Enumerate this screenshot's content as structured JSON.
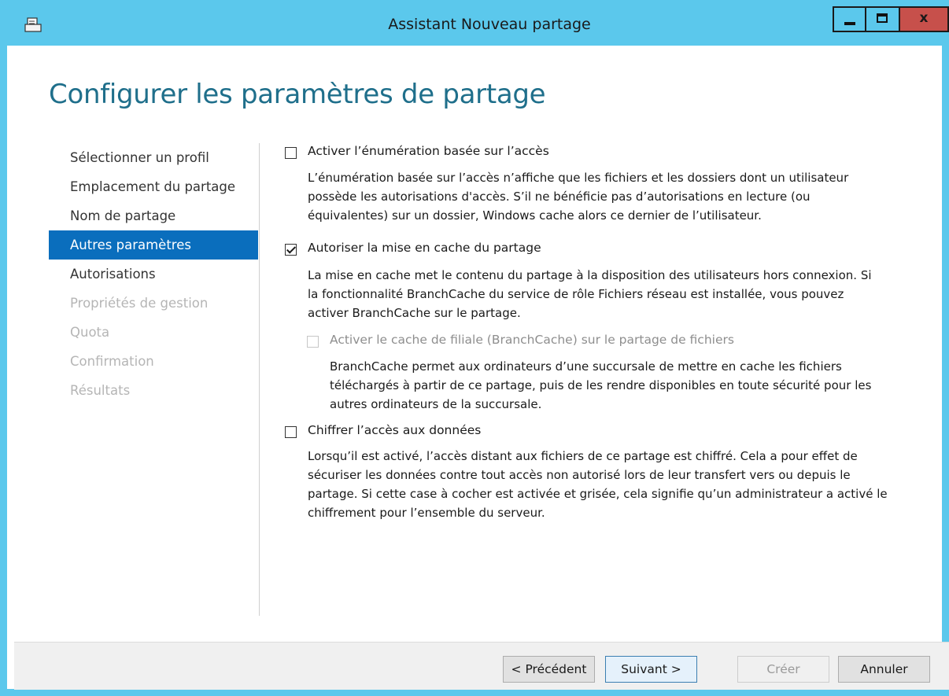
{
  "window": {
    "title": "Assistant Nouveau partage",
    "close_glyph": "x"
  },
  "page": {
    "heading": "Configurer les paramètres de partage"
  },
  "nav": {
    "items": [
      {
        "label": "Sélectionner un profil",
        "state": "normal"
      },
      {
        "label": "Emplacement du partage",
        "state": "normal"
      },
      {
        "label": "Nom de partage",
        "state": "normal"
      },
      {
        "label": "Autres paramètres",
        "state": "selected"
      },
      {
        "label": "Autorisations",
        "state": "normal"
      },
      {
        "label": "Propriétés de gestion",
        "state": "disabled"
      },
      {
        "label": "Quota",
        "state": "disabled"
      },
      {
        "label": "Confirmation",
        "state": "disabled"
      },
      {
        "label": "Résultats",
        "state": "disabled"
      }
    ]
  },
  "options": {
    "access_enum": {
      "label": "Activer l’énumération basée sur l’accès",
      "checked": false,
      "desc_lines": [
        "L’énumération basée sur l’accès n’affiche que les fichiers et les dossiers dont un utilisateur",
        "possède les autorisations d'accès. S’il ne bénéficie pas d’autorisations en lecture (ou",
        "équivalentes) sur un dossier, Windows cache alors ce dernier de l’utilisateur."
      ]
    },
    "caching": {
      "label": "Autoriser la mise en cache du partage",
      "checked": true,
      "desc_lines": [
        "La mise en cache met le contenu du partage à la disposition des utilisateurs hors connexion. Si",
        "la fonctionnalité BranchCache du service de rôle Fichiers réseau est installée, vous pouvez",
        "activer BranchCache sur le partage."
      ]
    },
    "branchcache": {
      "label": "Activer le cache de filiale (BranchCache) sur le partage de fichiers",
      "checked": false,
      "enabled": false,
      "desc_lines": [
        "BranchCache permet aux ordinateurs d’une succursale de mettre en cache les fichiers",
        "téléchargés à partir de ce partage, puis de les rendre disponibles en toute sécurité pour les",
        "autres ordinateurs de la succursale."
      ]
    },
    "encrypt": {
      "label": "Chiffrer l’accès aux données",
      "checked": false,
      "desc_lines": [
        "Lorsqu’il est activé, l’accès distant aux fichiers de ce partage est chiffré. Cela a pour effet de",
        "sécuriser les données contre tout accès non autorisé lors de leur transfert vers ou depuis le",
        "partage. Si cette case à cocher est activée et grisée, cela signifie qu’un administrateur a activé le",
        "chiffrement pour l’ensemble du serveur."
      ]
    }
  },
  "footer": {
    "previous": "< Précédent",
    "next": "Suivant >",
    "create": "Créer",
    "cancel": "Annuler"
  },
  "colors": {
    "titlebar": "#5bc8ec",
    "close_button": "#c7504b",
    "heading": "#1f6f8b",
    "nav_selected": "#0a6ebd"
  }
}
